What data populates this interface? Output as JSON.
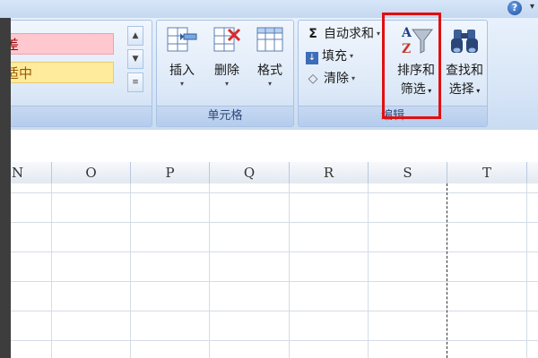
{
  "ribbon": {
    "styles": {
      "bad_label": "差",
      "neutral_label": "适中"
    },
    "cells_group": {
      "label": "单元格",
      "insert_label": "插入",
      "delete_label": "删除",
      "format_label": "格式"
    },
    "editing_group": {
      "label": "编辑",
      "autosum_label": "自动求和",
      "fill_label": "填充",
      "clear_label": "清除",
      "sort_filter_label_1": "排序和",
      "sort_filter_label_2": "筛选",
      "find_select_label_1": "查找和",
      "find_select_label_2": "选择"
    },
    "help_glyph": "?"
  },
  "sheet": {
    "columns": [
      "N",
      "O",
      "P",
      "Q",
      "R",
      "S",
      "T"
    ]
  },
  "colors": {
    "bad_bg": "#ffc7ce",
    "neutral_bg": "#ffeb9c",
    "highlight": "#e01010"
  }
}
